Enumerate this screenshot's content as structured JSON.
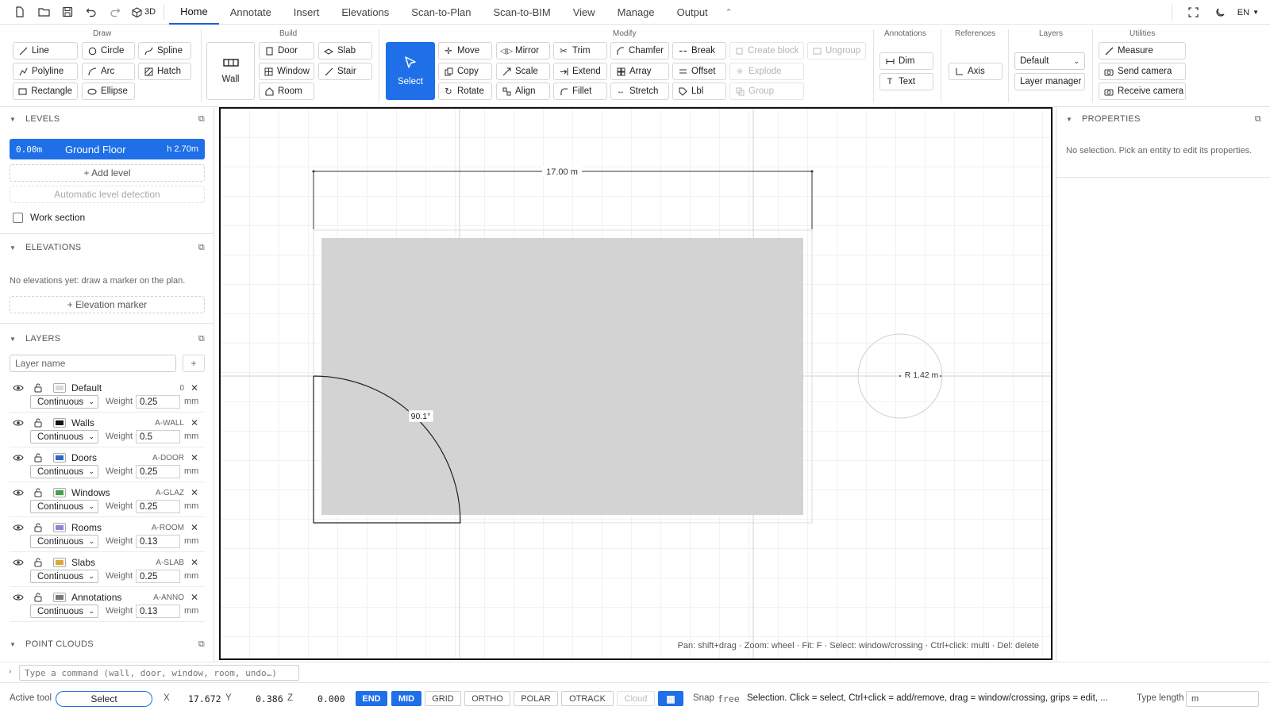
{
  "menubar": {
    "three_d_label": "3D",
    "tabs": [
      {
        "label": "Home",
        "active": true
      },
      {
        "label": "Annotate",
        "active": false
      },
      {
        "label": "Insert",
        "active": false
      },
      {
        "label": "Elevations",
        "active": false
      },
      {
        "label": "Scan-to-Plan",
        "active": false
      },
      {
        "label": "Scan-to-BIM",
        "active": false
      },
      {
        "label": "View",
        "active": false
      },
      {
        "label": "Manage",
        "active": false
      },
      {
        "label": "Output",
        "active": false
      }
    ],
    "lang": "EN"
  },
  "ribbon": {
    "groups": {
      "draw": "Draw",
      "build": "Build",
      "modify": "Modify",
      "annotations": "Annotations",
      "references": "References",
      "layers": "Layers",
      "utilities": "Utilities"
    },
    "draw": [
      "Line",
      "Circle",
      "Spline",
      "Polyline",
      "Arc",
      "Hatch",
      "Rectangle",
      "Ellipse"
    ],
    "build": {
      "wall": "Wall",
      "items": [
        "Door",
        "Slab",
        "Window",
        "Stair",
        "Room"
      ]
    },
    "modify": {
      "select": "Select",
      "items": [
        "Move",
        "Mirror",
        "Trim",
        "Chamfer",
        "Break",
        "Copy",
        "Scale",
        "Extend",
        "Array",
        "Offset",
        "Rotate",
        "Align",
        "Fillet",
        "Stretch",
        "Lbl"
      ],
      "block_items": [
        "Create block",
        "Ungroup",
        "Explode",
        "Group"
      ]
    },
    "annotations": [
      "Dim",
      "Text"
    ],
    "references": [
      "Axis"
    ],
    "layers": {
      "current": "Default",
      "manager": "Layer manager"
    },
    "utilities": [
      "Measure",
      "Send camera",
      "Receive camera"
    ]
  },
  "left": {
    "levels": {
      "title": "LEVELS",
      "current": {
        "elev": "0.00m",
        "name": "Ground Floor",
        "height": "h 2.70m"
      },
      "add_level": "+ Add level",
      "auto_detect": "Automatic level detection",
      "work_section": "Work section"
    },
    "elevations": {
      "title": "ELEVATIONS",
      "empty": "No elevations yet: draw a marker on the plan.",
      "add_marker": "+ Elevation marker"
    },
    "layers": {
      "title": "LAYERS",
      "name_placeholder": "Layer name",
      "add": "+",
      "weight_label": "Weight",
      "unit": "mm",
      "items": [
        {
          "name": "Default",
          "code": "0",
          "linetype": "Continuous",
          "weight": "0.25",
          "color": "#d8d8d8"
        },
        {
          "name": "Walls",
          "code": "A-WALL",
          "linetype": "Continuous",
          "weight": "0.5",
          "color": "#111111"
        },
        {
          "name": "Doors",
          "code": "A-DOOR",
          "linetype": "Continuous",
          "weight": "0.25",
          "color": "#2f66c8"
        },
        {
          "name": "Windows",
          "code": "A-GLAZ",
          "linetype": "Continuous",
          "weight": "0.25",
          "color": "#3fa34d"
        },
        {
          "name": "Rooms",
          "code": "A-ROOM",
          "linetype": "Continuous",
          "weight": "0.13",
          "color": "#9a7fd8"
        },
        {
          "name": "Slabs",
          "code": "A-SLAB",
          "linetype": "Continuous",
          "weight": "0.25",
          "color": "#d9a93a"
        },
        {
          "name": "Annotations",
          "code": "A-ANNO",
          "linetype": "Continuous",
          "weight": "0.13",
          "color": "#777777"
        }
      ]
    },
    "point_clouds": {
      "title": "POINT CLOUDS"
    }
  },
  "canvas": {
    "dimension_label": "17.00 m",
    "angle_label": "90.1°",
    "radius_label": "R 1.42 m",
    "hint": "Pan: shift+drag · Zoom: wheel · Fit: F · Select: window/crossing · Ctrl+click: multi · Del: delete"
  },
  "right": {
    "title": "PROPERTIES",
    "empty": "No selection. Pick an entity to edit its properties."
  },
  "command": {
    "placeholder": "Type a command (wall, door, window, room, undo…)"
  },
  "status": {
    "active_tool_label": "Active tool",
    "active_tool": "Select",
    "x_label": "X",
    "x": "17.672",
    "y_label": "Y",
    "y": "0.386",
    "z_label": "Z",
    "z": "0.000",
    "toggles": [
      "END",
      "MID",
      "GRID",
      "ORTHO",
      "POLAR",
      "OTRACK",
      "Cloud"
    ],
    "snap_label": "Snap",
    "snap_value": "free",
    "message": "Selection. Click = select, Ctrl+click = add/remove, drag = window/crossing, grips = edit, ...",
    "type_length_label": "Type length",
    "type_length_value": "m"
  }
}
